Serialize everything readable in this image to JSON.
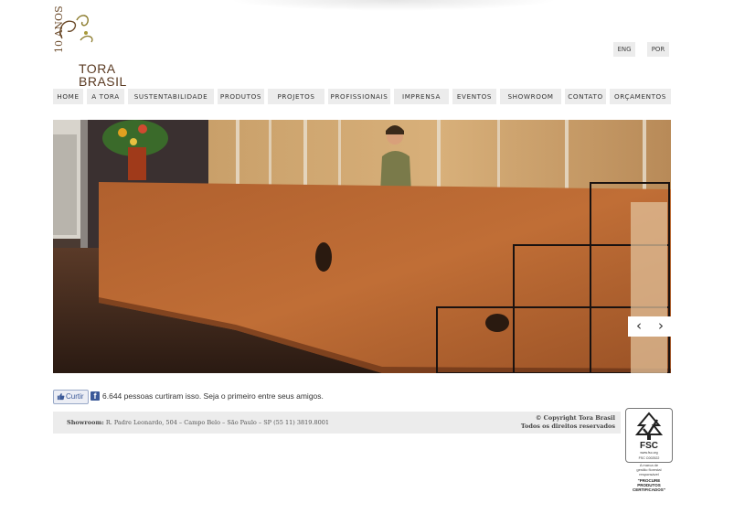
{
  "logo": {
    "anos": "10 ANOS",
    "line1": "TORA",
    "line2": "BRASIL"
  },
  "language": {
    "eng": "ENG",
    "por": "POR"
  },
  "nav": {
    "items": [
      {
        "label": "HOME"
      },
      {
        "label": "A TORA"
      },
      {
        "label": "SUSTENTABILIDADE"
      },
      {
        "label": "PRODUTOS"
      },
      {
        "label": "PROJETOS"
      },
      {
        "label": "PROFISSIONAIS"
      },
      {
        "label": "IMPRENSA"
      },
      {
        "label": "EVENTOS"
      },
      {
        "label": "SHOWROOM"
      },
      {
        "label": "CONTATO"
      },
      {
        "label": "ORÇAMENTOS"
      }
    ]
  },
  "slider": {
    "prev_icon": "‹",
    "next_icon": "›"
  },
  "facebook": {
    "like_label": "Curtir",
    "like_text": "6.644 pessoas curtiram isso. Seja o primeiro entre seus amigos.",
    "f_icon": "f"
  },
  "footer": {
    "showroom_label": "Showroom:",
    "showroom_address": "R. Padre Leonardo, 504 – Campo Belo – São Paulo – SP  (55 11) 3819.8001",
    "copyright": "© Copyright Tora Brasil",
    "rights": "Todos os direitos reservados"
  },
  "fsc": {
    "title": "FSC",
    "site": "www.fsc.org",
    "code": "FSC C002522",
    "note1": "A marca de",
    "note2": "gestão florestal",
    "note3": "responsável",
    "procure1": "\"PROCURE",
    "procure2": "PRODUTOS",
    "procure3": "CERTIFICADOS\""
  },
  "colors": {
    "nav_bg": "#ececec",
    "footer_bg": "#ececec",
    "logo_brown": "#5a3a22",
    "facebook_blue": "#3b5998"
  }
}
